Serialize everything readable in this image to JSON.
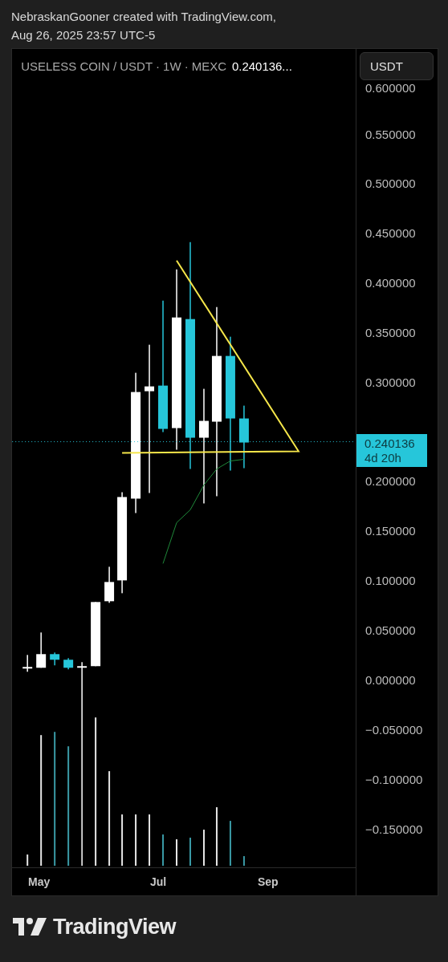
{
  "attribution": {
    "line_1": "NebraskanGooner created with TradingView.com,",
    "line_2": "Aug 26, 2025 23:57 UTC-5"
  },
  "legend": {
    "symbol": "USELESS COIN / USDT · 1W · MEXC",
    "price": "0.240136..."
  },
  "currency_button": "USDT",
  "price_axis": [
    "0.600000",
    "0.550000",
    "0.500000",
    "0.450000",
    "0.400000",
    "0.350000",
    "0.300000",
    "0.200000",
    "0.150000",
    "0.100000",
    "0.050000",
    "0.000000",
    "−0.050000",
    "−0.100000",
    "−0.150000"
  ],
  "last_price": {
    "price": "0.240136",
    "countdown": "4d 20h"
  },
  "time_axis": [
    "May",
    "Jul",
    "Sep"
  ],
  "brand": "TradingView"
}
